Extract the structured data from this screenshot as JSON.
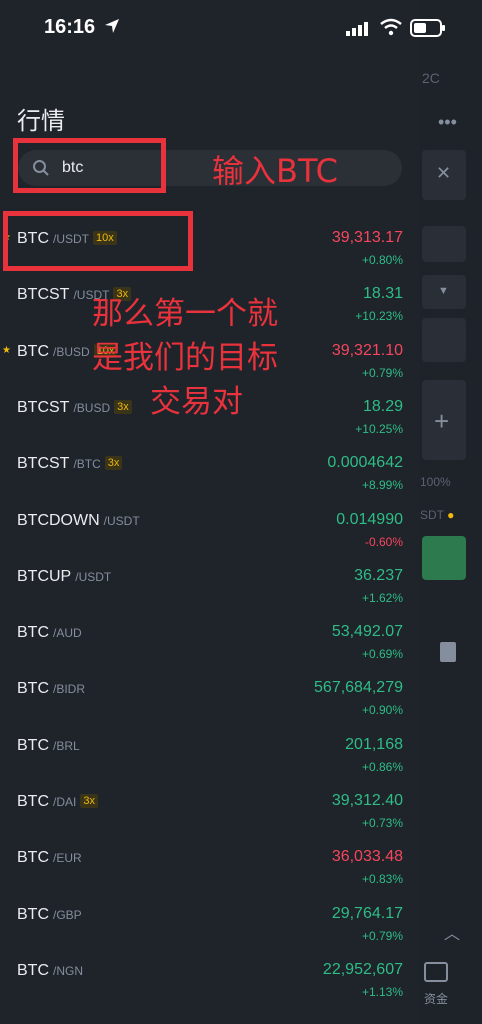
{
  "status": {
    "time": "16:16"
  },
  "background": {
    "partial_label": "2C",
    "percent": "100%",
    "asset_partial": "SDT",
    "tab_label": "资金"
  },
  "drawer": {
    "title": "行情",
    "search": {
      "value": "btc"
    }
  },
  "annotations": {
    "search_hint": "输入BTC",
    "first_line": "那么第一个就",
    "second_line": "是我们的目标",
    "third_line": "交易对"
  },
  "markets": [
    {
      "base": "BTC",
      "quote": "/USDT",
      "leverage": "10x",
      "price": "39,313.17",
      "change": "+0.80%",
      "price_color": "down",
      "change_color": "up",
      "favorite": true
    },
    {
      "base": "BTCST",
      "quote": "/USDT",
      "leverage": "3x",
      "price": "18.31",
      "change": "+10.23%",
      "price_color": "up",
      "change_color": "up",
      "favorite": false
    },
    {
      "base": "BTC",
      "quote": "/BUSD",
      "leverage": "10x",
      "price": "39,321.10",
      "change": "+0.79%",
      "price_color": "down",
      "change_color": "up",
      "favorite": true
    },
    {
      "base": "BTCST",
      "quote": "/BUSD",
      "leverage": "3x",
      "price": "18.29",
      "change": "+10.25%",
      "price_color": "up",
      "change_color": "up",
      "favorite": false
    },
    {
      "base": "BTCST",
      "quote": "/BTC",
      "leverage": "3x",
      "price": "0.0004642",
      "change": "+8.99%",
      "price_color": "up",
      "change_color": "up",
      "favorite": false
    },
    {
      "base": "BTCDOWN",
      "quote": "/USDT",
      "leverage": "",
      "price": "0.014990",
      "change": "-0.60%",
      "price_color": "up",
      "change_color": "down",
      "favorite": false
    },
    {
      "base": "BTCUP",
      "quote": "/USDT",
      "leverage": "",
      "price": "36.237",
      "change": "+1.62%",
      "price_color": "up",
      "change_color": "up",
      "favorite": false
    },
    {
      "base": "BTC",
      "quote": "/AUD",
      "leverage": "",
      "price": "53,492.07",
      "change": "+0.69%",
      "price_color": "up",
      "change_color": "up",
      "favorite": false
    },
    {
      "base": "BTC",
      "quote": "/BIDR",
      "leverage": "",
      "price": "567,684,279",
      "change": "+0.90%",
      "price_color": "up",
      "change_color": "up",
      "favorite": false
    },
    {
      "base": "BTC",
      "quote": "/BRL",
      "leverage": "",
      "price": "201,168",
      "change": "+0.86%",
      "price_color": "up",
      "change_color": "up",
      "favorite": false
    },
    {
      "base": "BTC",
      "quote": "/DAI",
      "leverage": "3x",
      "price": "39,312.40",
      "change": "+0.73%",
      "price_color": "up",
      "change_color": "up",
      "favorite": false
    },
    {
      "base": "BTC",
      "quote": "/EUR",
      "leverage": "",
      "price": "36,033.48",
      "change": "+0.83%",
      "price_color": "down",
      "change_color": "up",
      "favorite": false
    },
    {
      "base": "BTC",
      "quote": "/GBP",
      "leverage": "",
      "price": "29,764.17",
      "change": "+0.79%",
      "price_color": "up",
      "change_color": "up",
      "favorite": false
    },
    {
      "base": "BTC",
      "quote": "/NGN",
      "leverage": "",
      "price": "22,952,607",
      "change": "+1.13%",
      "price_color": "up",
      "change_color": "up",
      "favorite": false
    }
  ],
  "colors": {
    "up": "#2ebd85",
    "down": "#f6465d",
    "accent": "#f0b90b",
    "annotation": "#e8323c"
  }
}
